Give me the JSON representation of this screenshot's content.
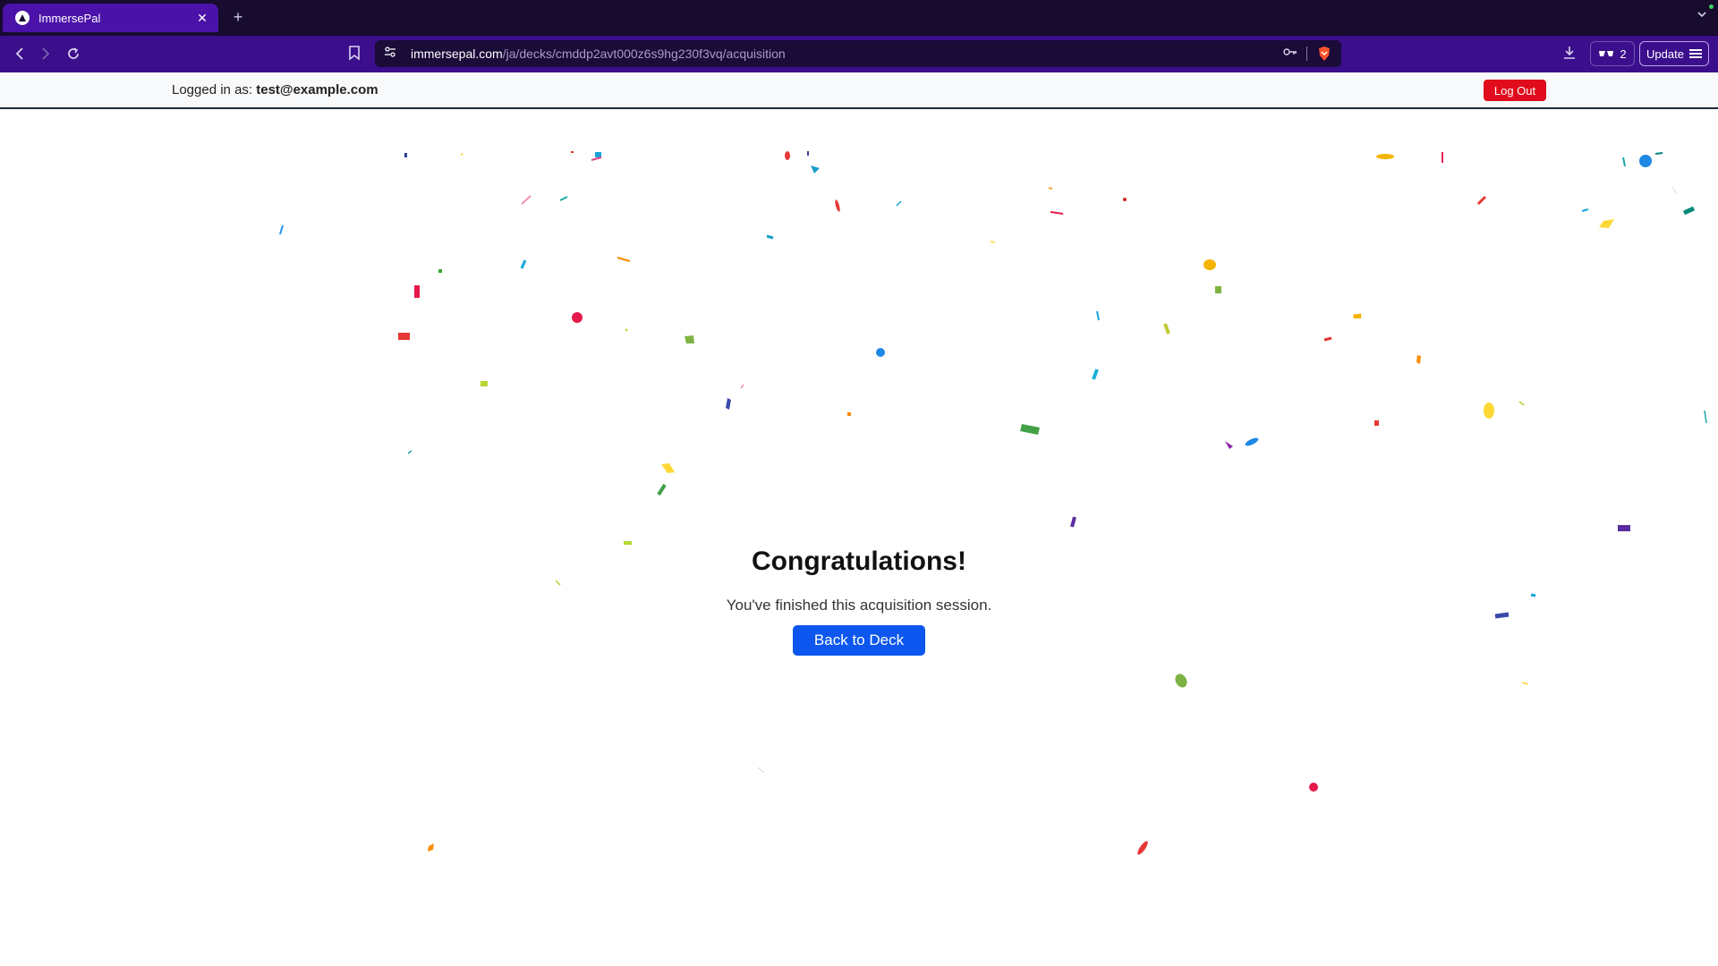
{
  "browser": {
    "tab_title": "ImmersePal",
    "url_domain": "immersepal.com",
    "url_path": "/ja/decks/cmddp2avt000z6s9hg230f3vq/acquisition",
    "wallet_count": "2",
    "update_label": "Update"
  },
  "header": {
    "logged_in_label": "Logged in as:",
    "user_email": "test@example.com",
    "logout_label": "Log Out"
  },
  "main": {
    "title": "Congratulations!",
    "subtitle": "You've finished this acquisition session.",
    "back_button_label": "Back to Deck"
  },
  "colors": {
    "tab_active": "#4a12a8",
    "toolbar": "#3b0e8c",
    "logout": "#e00b1c",
    "primary_button": "#0d57f0"
  },
  "icons": [
    "logo-icon",
    "close-icon",
    "plus-icon",
    "back-icon",
    "forward-icon",
    "reload-icon",
    "bookmark-icon",
    "site-settings-icon",
    "key-icon",
    "brave-shield-icon",
    "download-icon",
    "wallet-icon",
    "menu-icon",
    "chevron-down-icon"
  ]
}
